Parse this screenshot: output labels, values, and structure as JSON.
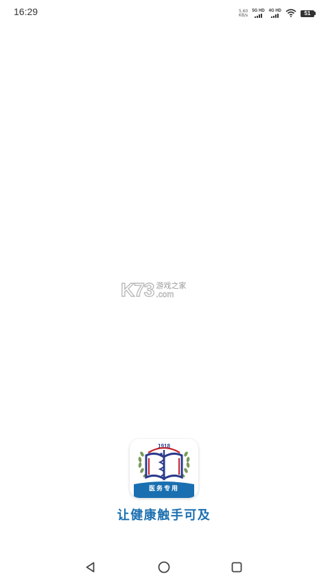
{
  "status_bar": {
    "time": "16:29",
    "net_speed_value": "5.60",
    "net_speed_unit": "KB/s",
    "signal_1_label": "5G HD",
    "signal_2_label": "4G HD",
    "battery_level": "51"
  },
  "watermark": {
    "mark": "K73",
    "chinese": "游戏之家",
    "domain": ".com"
  },
  "app_logo": {
    "year": "1918",
    "ribbon_text": "医务专用"
  },
  "slogan": "让健康触手可及",
  "colors": {
    "brand_blue": "#1a6fb0",
    "logo_navy": "#2b3a8c",
    "logo_red": "#c0202a",
    "logo_green": "#7a9a5a"
  },
  "icons": {
    "wifi": "wifi-icon",
    "battery": "battery-icon",
    "back": "back-triangle-icon",
    "home": "home-circle-icon",
    "recents": "recents-square-icon"
  }
}
